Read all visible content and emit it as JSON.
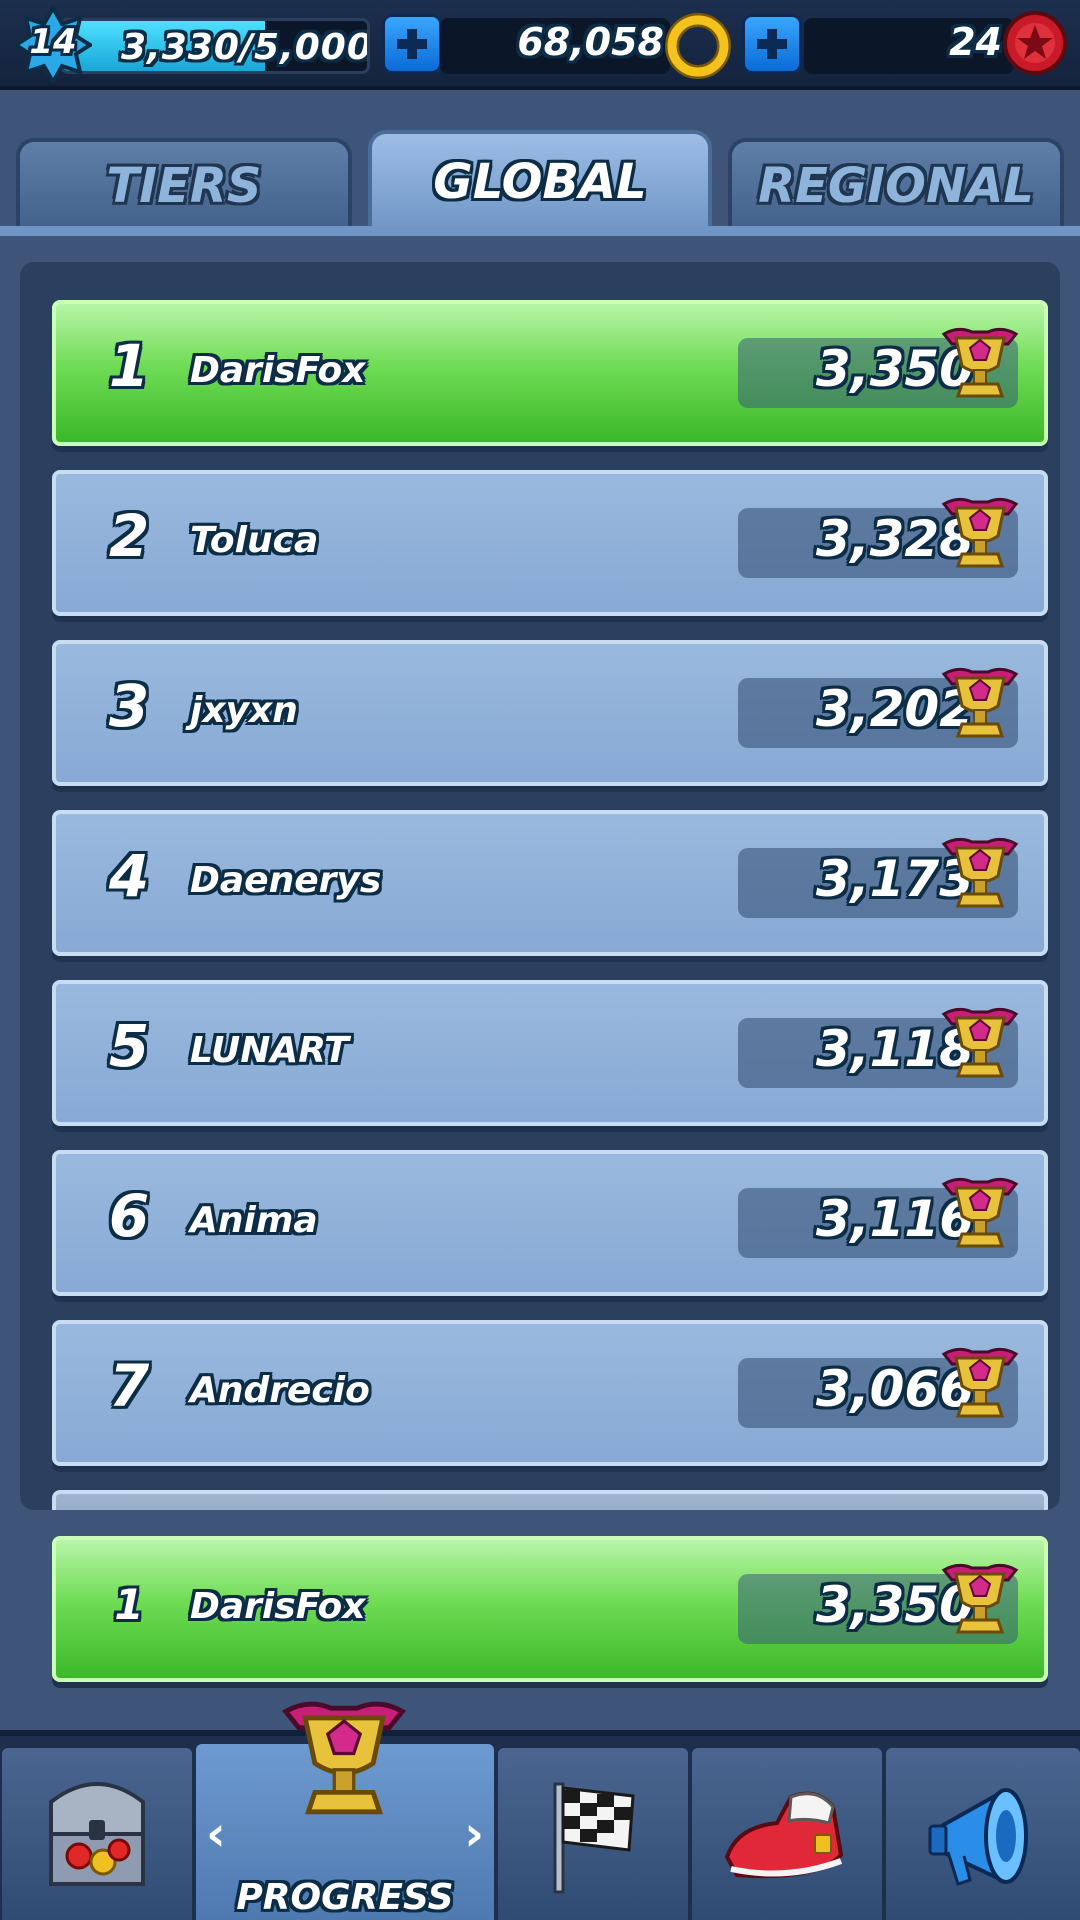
{
  "topbar": {
    "level": "14",
    "xp_text": "3,330/5,000",
    "xp_progress": 0.666,
    "coins": "68,058",
    "red_stars": "24"
  },
  "tabs": [
    {
      "label": "TIERS",
      "active": false
    },
    {
      "label": "GLOBAL",
      "active": true
    },
    {
      "label": "REGIONAL",
      "active": false
    }
  ],
  "leaderboard": [
    {
      "rank": "1",
      "name": "DarisFox",
      "score": "3,350",
      "highlight": true
    },
    {
      "rank": "2",
      "name": "Toluca",
      "score": "3,328",
      "highlight": false
    },
    {
      "rank": "3",
      "name": "jxyxn",
      "score": "3,202",
      "highlight": false
    },
    {
      "rank": "4",
      "name": "Daenerys",
      "score": "3,173",
      "highlight": false
    },
    {
      "rank": "5",
      "name": "LUNART",
      "score": "3,118",
      "highlight": false
    },
    {
      "rank": "6",
      "name": "Anima",
      "score": "3,116",
      "highlight": false
    },
    {
      "rank": "7",
      "name": "Andrecio",
      "score": "3,066",
      "highlight": false
    }
  ],
  "player": {
    "rank": "1",
    "name": "DarisFox",
    "score": "3,350"
  },
  "bottom_nav": {
    "items": [
      {
        "icon": "treasure-chest-icon",
        "label": ""
      },
      {
        "icon": "trophy-icon",
        "label": "PROGRESS",
        "active": true
      },
      {
        "icon": "checkered-flag-icon",
        "label": ""
      },
      {
        "icon": "sneaker-icon",
        "label": ""
      },
      {
        "icon": "megaphone-icon",
        "label": ""
      }
    ]
  },
  "colors": {
    "highlight_row": "#4cc834",
    "row": "#8fb0d8",
    "accent_blue": "#1a8ae8",
    "text_outline": "#0d2c45"
  }
}
